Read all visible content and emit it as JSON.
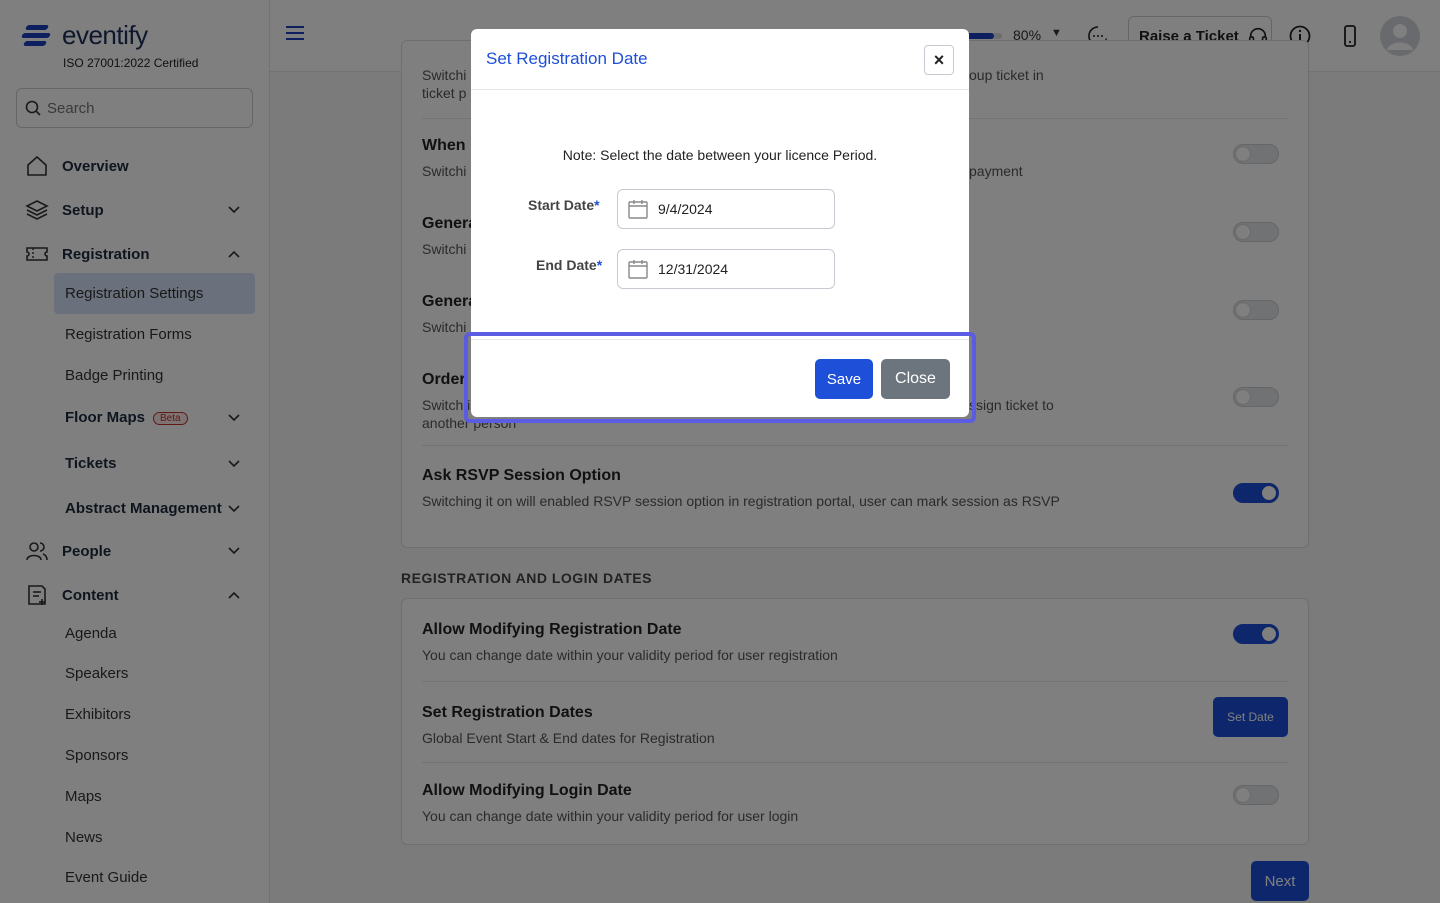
{
  "brand": {
    "name": "eventify",
    "certification": "ISO 27001:2022 Certified"
  },
  "search": {
    "placeholder": "Search"
  },
  "sidebar": {
    "items": [
      {
        "label": "Overview"
      },
      {
        "label": "Setup"
      },
      {
        "label": "Registration"
      },
      {
        "label": "People"
      },
      {
        "label": "Content"
      }
    ],
    "registration_sub": [
      {
        "label": "Registration Settings"
      },
      {
        "label": "Registration Forms"
      },
      {
        "label": "Badge Printing"
      },
      {
        "label": "Floor Maps",
        "badge": "Beta"
      },
      {
        "label": "Tickets"
      },
      {
        "label": "Abstract Management"
      }
    ],
    "content_sub": [
      "Agenda",
      "Speakers",
      "Exhibitors",
      "Sponsors",
      "Maps",
      "News",
      "Event Guide"
    ]
  },
  "topbar": {
    "progress_percent": 80,
    "progress_label": "80%",
    "raise_ticket": "Raise a Ticket"
  },
  "main": {
    "rows_top": [
      {
        "title": "",
        "desc_left": "Switchi",
        "desc_left2": "ticket p",
        "desc_right": "oup ticket in"
      },
      {
        "title": "When",
        "desc_left": "Switchi",
        "desc_right": "payment",
        "toggle": false
      },
      {
        "title": "Genera",
        "desc_left": "Switchi",
        "toggle": false
      },
      {
        "title": "Genera",
        "desc_left": "Switchi",
        "toggle": false
      },
      {
        "title": "Order",
        "desc_left": "Switch i",
        "desc_left2": "another person",
        "desc_right": "ssign ticket to",
        "toggle": false
      }
    ],
    "rsvp": {
      "title": "Ask RSVP Session Option",
      "desc": "Switching it on will enabled RSVP session option in registration portal, user can mark session as RSVP",
      "toggle": true
    },
    "section_heading": "REGISTRATION AND LOGIN DATES",
    "allow_reg_date": {
      "title": "Allow Modifying Registration Date",
      "desc": "You can change date within your validity period for user registration",
      "toggle": true
    },
    "set_reg_dates": {
      "title": "Set Registration Dates",
      "desc": "Global Event Start & End dates for Registration",
      "button": "Set Date"
    },
    "allow_login_date": {
      "title": "Allow Modifying Login Date",
      "desc": "You can change date within your validity period for user login",
      "toggle": false
    },
    "next_button": "Next"
  },
  "modal": {
    "title": "Set Registration Date",
    "close_x": "×",
    "note": "Note: Select the date between your licence Period.",
    "start_label": "Start Date",
    "end_label": "End Date",
    "required_mark": "*",
    "start_value": "9/4/2024",
    "end_value": "12/31/2024",
    "save": "Save",
    "close": "Close"
  }
}
